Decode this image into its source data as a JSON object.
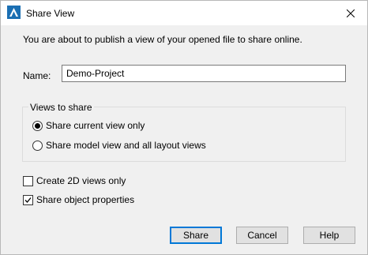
{
  "window": {
    "title": "Share View"
  },
  "intro_text": "You are about to publish a view of your opened file to share online.",
  "name_field": {
    "label": "Name:",
    "value": "Demo-Project"
  },
  "views_group": {
    "title": "Views to share",
    "options": [
      {
        "label": "Share current view only",
        "selected": true
      },
      {
        "label": "Share model view and all layout views",
        "selected": false
      }
    ]
  },
  "checkboxes": [
    {
      "label": "Create 2D views only",
      "checked": false
    },
    {
      "label": "Share object properties",
      "checked": true
    }
  ],
  "buttons": {
    "share": "Share",
    "cancel": "Cancel",
    "help": "Help"
  },
  "colors": {
    "accent": "#0078d7",
    "window_bg": "#f0f0f0"
  }
}
